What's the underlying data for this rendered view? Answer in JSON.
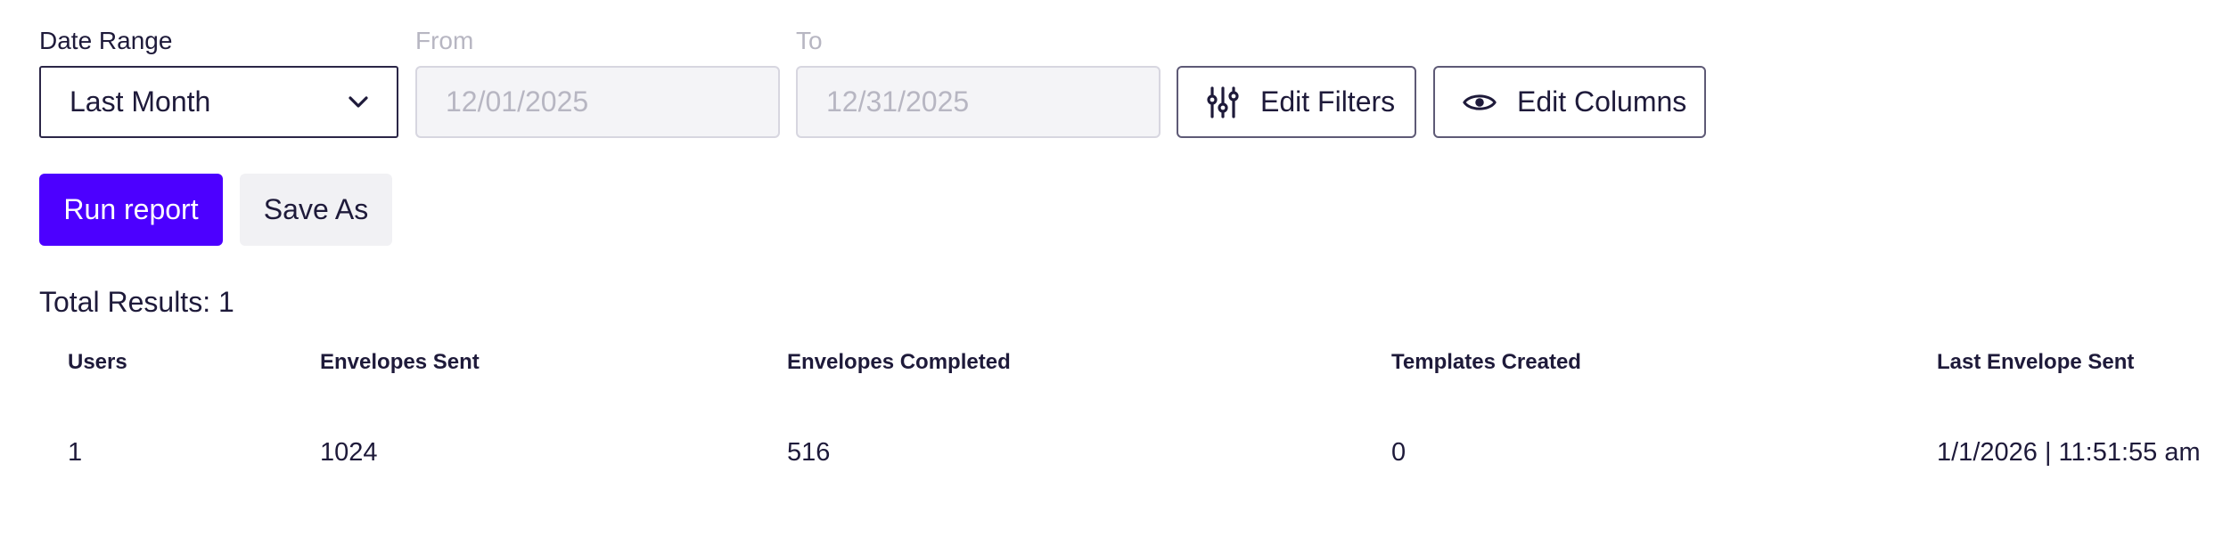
{
  "filters": {
    "date_range_label": "Date Range",
    "date_range_value": "Last Month",
    "from_label": "From",
    "from_value": "12/01/2025",
    "to_label": "To",
    "to_value": "12/31/2025",
    "edit_filters_label": "Edit Filters",
    "edit_columns_label": "Edit Columns",
    "icons": {
      "dropdown": "chevron-down-icon",
      "edit_filters": "sliders-icon",
      "edit_columns": "eye-icon"
    }
  },
  "actions": {
    "run_report_label": "Run report",
    "save_as_label": "Save As"
  },
  "results": {
    "total_label": "Total Results: 1"
  },
  "table": {
    "columns": [
      "Users",
      "Envelopes Sent",
      "Envelopes Completed",
      "Templates Created",
      "Last Envelope Sent"
    ],
    "rows": [
      [
        "1",
        "1024",
        "516",
        "0",
        "1/1/2026 | 11:51:55 am"
      ]
    ]
  },
  "colors": {
    "primary": "#4c00ff",
    "text": "#1e1a3a",
    "disabled_text": "#b7b6c2",
    "disabled_bg": "#f4f4f7",
    "secondary_bg": "#f1f1f4"
  }
}
